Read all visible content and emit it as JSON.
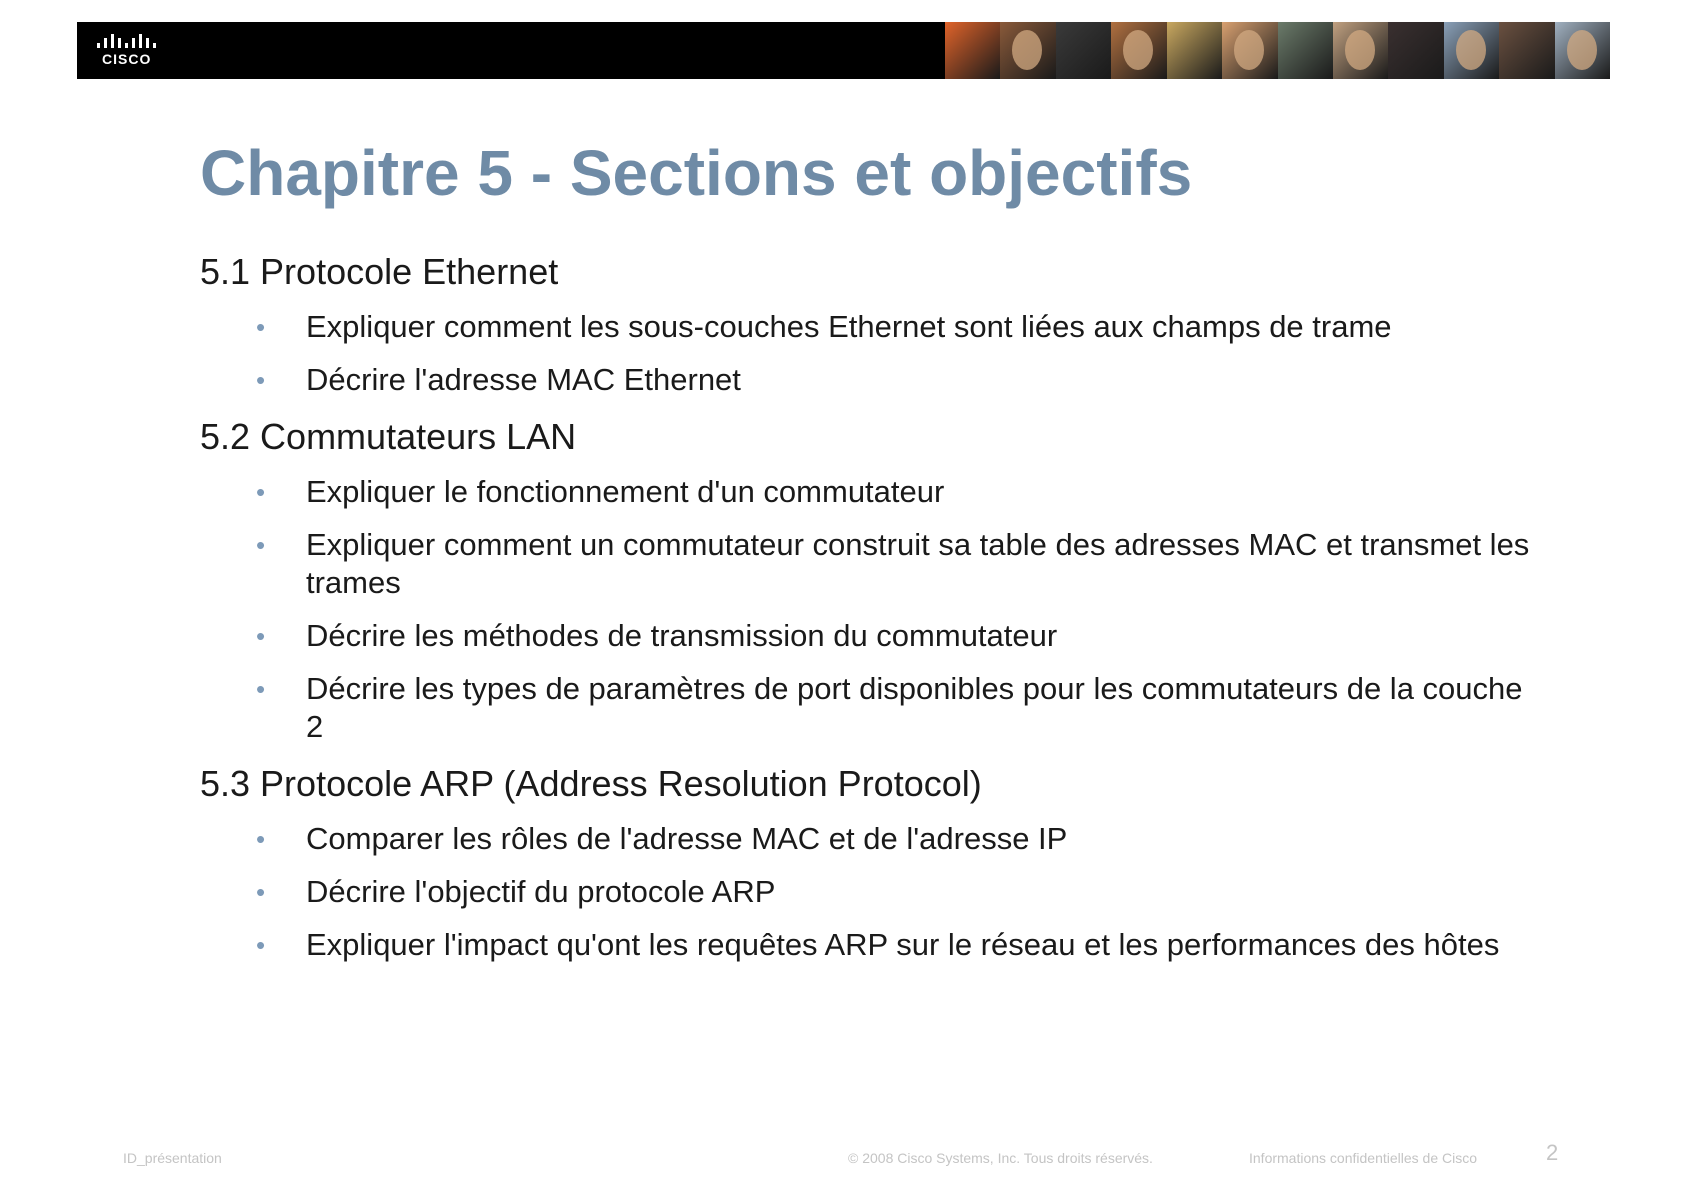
{
  "header": {
    "logo_text": "CISCO",
    "photo_strip_colors": [
      "#e0632a",
      "#8a5a3a",
      "#3a3a3a",
      "#b07040",
      "#c9a860",
      "#d8a070",
      "#6b7b6a",
      "#c0a080",
      "#3a3030",
      "#8aa0b8",
      "#6a5040",
      "#a0b0c0"
    ]
  },
  "title": "Chapitre 5 - Sections et objectifs",
  "sections": [
    {
      "heading": "5.1 Protocole Ethernet",
      "bullets": [
        "Expliquer comment les sous-couches Ethernet sont liées aux champs de trame",
        "Décrire l'adresse MAC Ethernet"
      ]
    },
    {
      "heading": "5.2 Commutateurs LAN",
      "bullets": [
        "Expliquer le fonctionnement d'un commutateur",
        "Expliquer comment un commutateur construit sa table des adresses MAC et transmet les trames",
        "Décrire les méthodes de transmission du commutateur",
        "Décrire les types de paramètres de port disponibles pour les commutateurs de la couche 2"
      ]
    },
    {
      "heading": "5.3 Protocole ARP (Address Resolution Protocol)",
      "bullets": [
        "Comparer les rôles de l'adresse MAC et de l'adresse IP",
        "Décrire l'objectif du protocole ARP",
        "Expliquer l'impact qu'ont les requêtes ARP sur le réseau et les performances des hôtes"
      ]
    }
  ],
  "footer": {
    "presentation_id": "ID_présentation",
    "copyright": "© 2008 Cisco Systems, Inc. Tous droits réservés.",
    "confidential": "Informations confidentielles de Cisco",
    "page_number": "2"
  },
  "colors": {
    "title": "#6f8ba6",
    "bullet": "#7d9ab8",
    "footer": "#c4c4c4"
  }
}
